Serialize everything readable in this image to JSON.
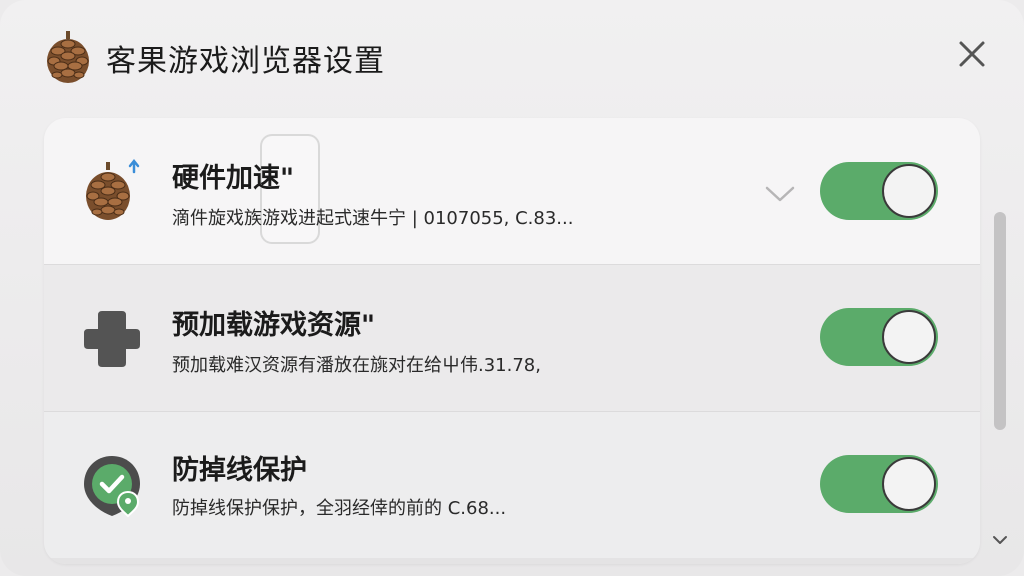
{
  "window": {
    "title": "客果游戏浏览器设置",
    "logo_icon": "pinecone-icon",
    "close_icon": "close-icon"
  },
  "settings": [
    {
      "name": "硬件加速\"",
      "desc": "滴件旋戏族游戏进起式速牛宁 | 0107055, C.83...",
      "icon": "pinecone-boost-icon",
      "enabled": true,
      "expand_icon": "chevron-down-icon"
    },
    {
      "name": "预加载游戏资源\"",
      "desc": "预加载难汉资源有潘放在旐对在给屮伟.31.78,",
      "icon": "plus-cross-icon",
      "enabled": true
    },
    {
      "name": "防掉线保护",
      "desc": "防掉线保护保护，全羽经倖的前的 C.68...",
      "icon": "shield-check-icon",
      "enabled": true
    }
  ],
  "scrollbar": {
    "down_icon": "chevron-down-icon"
  },
  "colors": {
    "toggle_on": "#5bab6a",
    "background": "#ecebec",
    "panel": "#f0eff0"
  }
}
